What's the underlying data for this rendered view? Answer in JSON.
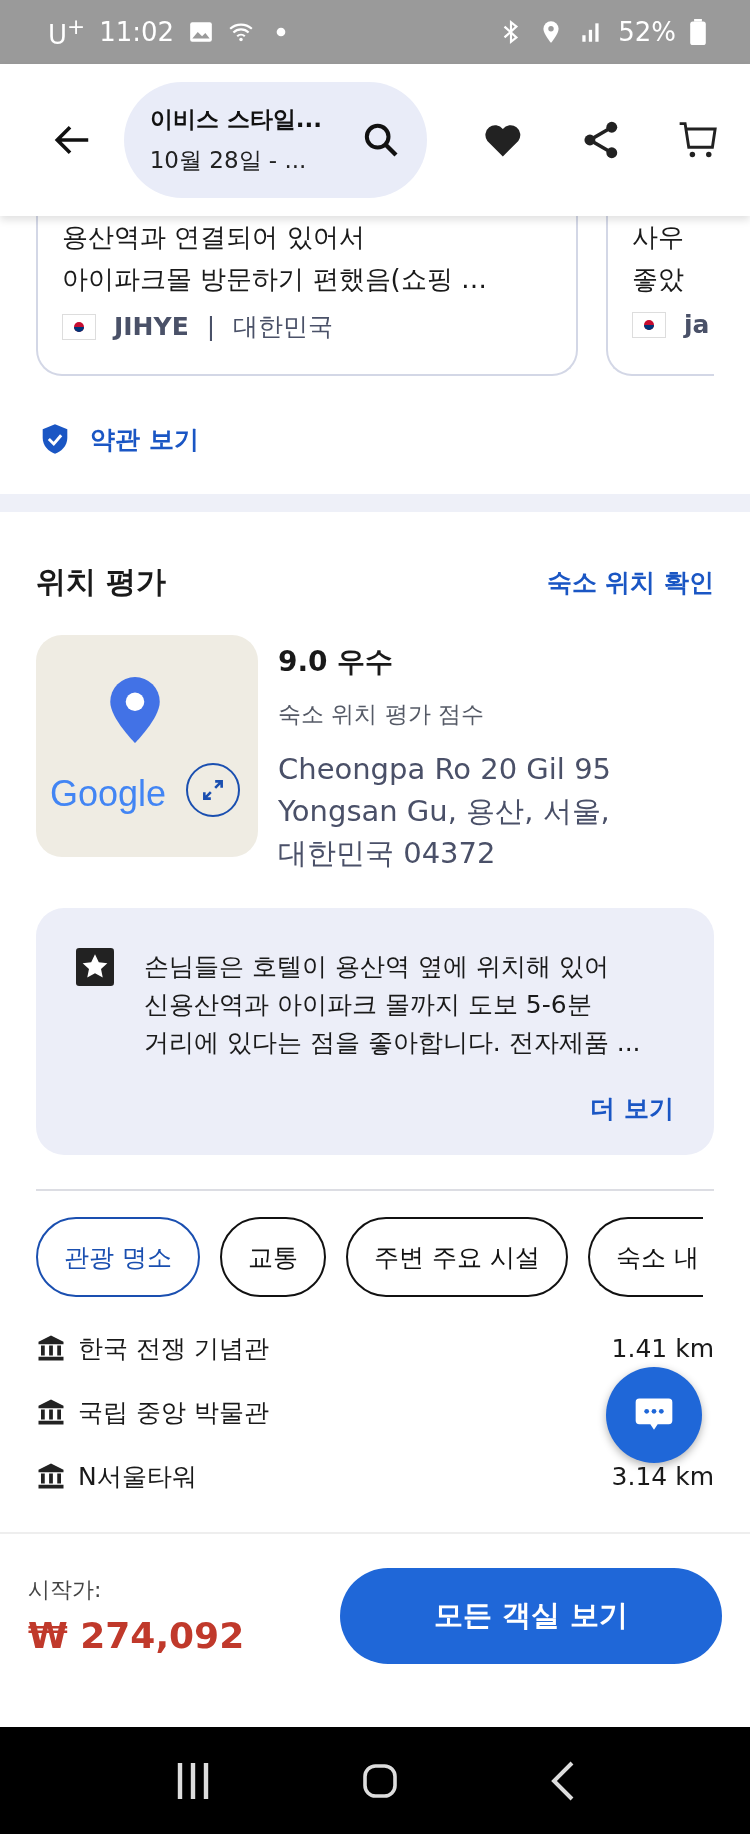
{
  "status_bar": {
    "carrier": "U$^{+}$",
    "time": "11:02",
    "battery": "52%"
  },
  "header": {
    "title": "이비스 스타일...",
    "dates": "10월 28일 - ..."
  },
  "review_cards": [
    {
      "lines": [
        "용산역과 연결되어 있어서",
        "아이파크몰 방문하기 편했음(쇼핑 …"
      ],
      "author": "JIHYE",
      "separator": "|",
      "country": "대한민국"
    },
    {
      "lines": [
        "사우",
        "좋았"
      ],
      "author": "ja"
    }
  ],
  "terms_link": "약관 보기",
  "location": {
    "title": "위치 평가",
    "link": "숙소 위치 확인",
    "map_logo": "Google",
    "score": "9.0 우수",
    "score_label": "숙소 위치 평가 점수",
    "address": [
      "Cheongpa Ro 20 Gil 95",
      "Yongsan Gu, 용산, 서울,",
      "대한민국 04372"
    ],
    "summary": "손님들은 호텔이 용산역 옆에 위치해 있어 신용산역과 아이파크 몰까지 도보 5-6분 거리에 있다는 점을 좋아합니다. 전자제품 ...",
    "more": "더 보기"
  },
  "chips": [
    {
      "label": "관광 명소",
      "selected": true
    },
    {
      "label": "교통",
      "selected": false
    },
    {
      "label": "주변 주요 시설",
      "selected": false
    },
    {
      "label": "숙소 내",
      "selected": false
    }
  ],
  "places": [
    {
      "name": "한국 전쟁 기념관",
      "distance": "1.41 km"
    },
    {
      "name": "국립 중앙 박물관"
    },
    {
      "name": "N서울타워",
      "distance": "3.14 km"
    }
  ],
  "bottom_bar": {
    "price_label": "시작가:",
    "price": "₩ 274,092",
    "button": "모든 객실 보기"
  }
}
